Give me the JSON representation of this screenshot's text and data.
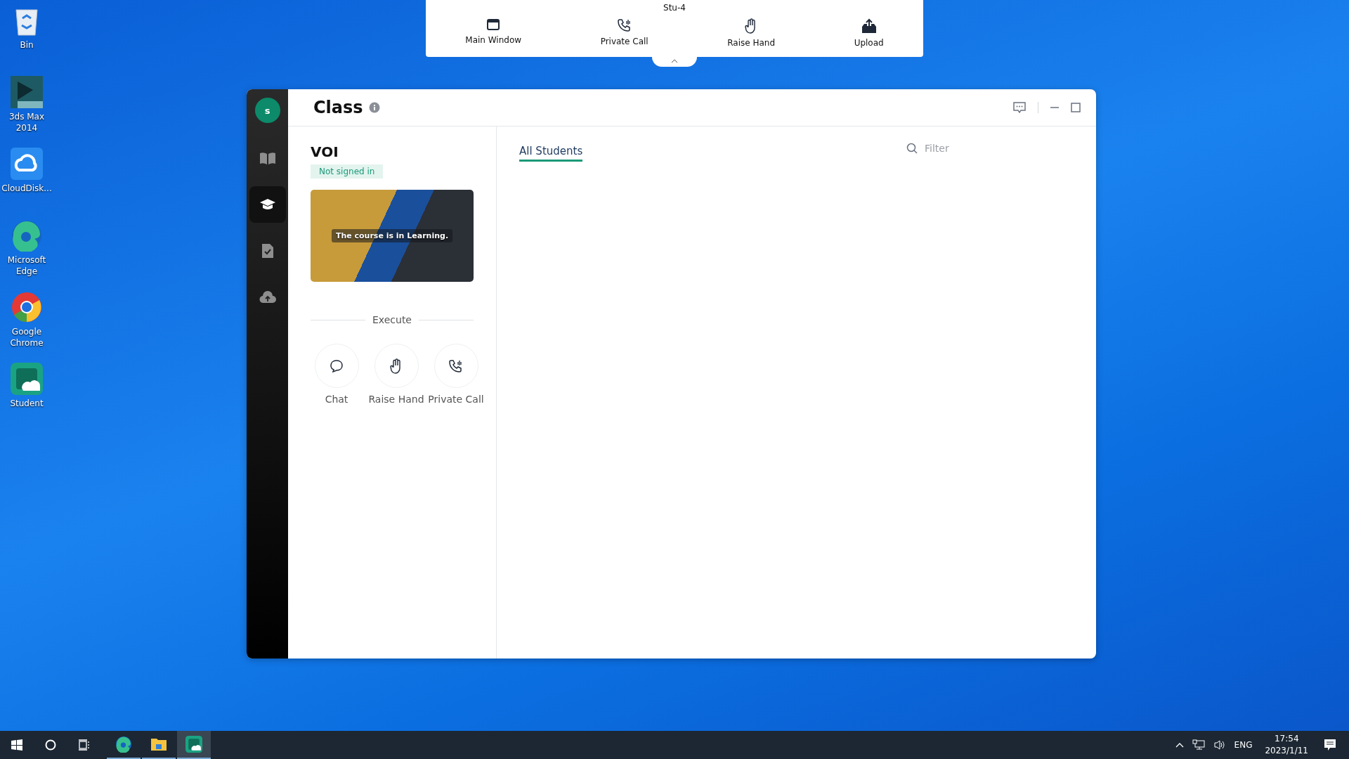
{
  "desktop_icons": [
    {
      "label": "Bin",
      "kind": "bin"
    },
    {
      "label": "3ds Max 2014",
      "kind": "max"
    },
    {
      "label": "CloudDisk...",
      "kind": "cloud"
    },
    {
      "label": "Microsoft Edge",
      "kind": "edge"
    },
    {
      "label": "Google Chrome",
      "kind": "chrome"
    },
    {
      "label": "Student",
      "kind": "student"
    }
  ],
  "toolbar": {
    "title": "Stu-4",
    "buttons": [
      {
        "label": "Main Window",
        "kind": "window"
      },
      {
        "label": "Private Call",
        "kind": "call"
      },
      {
        "label": "Raise Hand",
        "kind": "hand"
      },
      {
        "label": "Upload",
        "kind": "upload"
      }
    ]
  },
  "window": {
    "title": "Class",
    "avatar": "s",
    "nav": [
      {
        "kind": "book",
        "selected": false
      },
      {
        "kind": "cap",
        "selected": true
      },
      {
        "kind": "task",
        "selected": false
      },
      {
        "kind": "upload",
        "selected": false
      }
    ],
    "course": {
      "name": "VOI",
      "status": "Not signed in",
      "caption": "The course is in Learning."
    },
    "section_label": "Execute",
    "actions": [
      {
        "label": "Chat",
        "kind": "chat"
      },
      {
        "label": "Raise Hand",
        "kind": "hand"
      },
      {
        "label": "Private Call",
        "kind": "call"
      }
    ],
    "tabs": [
      {
        "label": "All Students",
        "selected": true
      }
    ],
    "filter": {
      "placeholder": "Filter"
    }
  },
  "taskbar": {
    "apps": [
      {
        "kind": "edge",
        "selected": false
      },
      {
        "kind": "explorer",
        "selected": false
      },
      {
        "kind": "student",
        "selected": true
      }
    ],
    "language": "ENG",
    "time": "17:54",
    "date": "2023/1/11"
  }
}
